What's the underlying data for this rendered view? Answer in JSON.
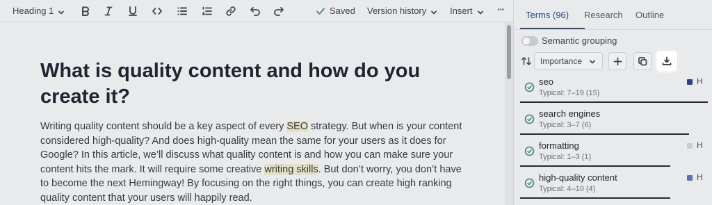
{
  "toolbar": {
    "heading_label": "Heading 1",
    "saved_label": "Saved",
    "version_history_label": "Version history",
    "insert_label": "Insert",
    "more_label": "···"
  },
  "document": {
    "title": "What is quality content and how do you create it?",
    "body_parts": [
      "Writing quality content should be a key aspect of every ",
      "SEO",
      " strategy. But when is your content considered high-quality? And does high-quality mean the same for your users as it does for Google? In this article, we’ll discuss what quality content is and how you can make sure your content hits the mark. It will require some creative ",
      "writing skills",
      ". But don’t worry, you don’t have to become the next Hemingway! By focusing on the right things, you can create high ranking quality content that your users will happily read."
    ]
  },
  "sidebar": {
    "tabs": [
      {
        "label": "Terms (96)",
        "active": true
      },
      {
        "label": "Research",
        "active": false
      },
      {
        "label": "Outline",
        "active": false
      }
    ],
    "semantic_grouping_label": "Semantic grouping",
    "sort_select_value": "Importance",
    "terms": [
      {
        "name": "seo",
        "typical": "Typical: 7–19 (15)",
        "marker_color": "#2a3f8f",
        "h_label": "H",
        "progress": 1.0
      },
      {
        "name": "search engines",
        "typical": "Typical: 3–7 (6)",
        "marker_color": "",
        "h_label": "",
        "progress": 0.9
      },
      {
        "name": "formatting",
        "typical": "Typical: 1–3 (1)",
        "marker_color": "#c9c9dc",
        "h_label": "H",
        "progress": 0.8
      },
      {
        "name": "high-quality content",
        "typical": "Typical: 4–10 (4)",
        "marker_color": "#5b6fb8",
        "h_label": "H",
        "progress": 0.8
      }
    ]
  },
  "colors": {
    "accent": "#2b4a7a",
    "check_green": "#3f8a73",
    "highlight": "#e5e1c4"
  }
}
